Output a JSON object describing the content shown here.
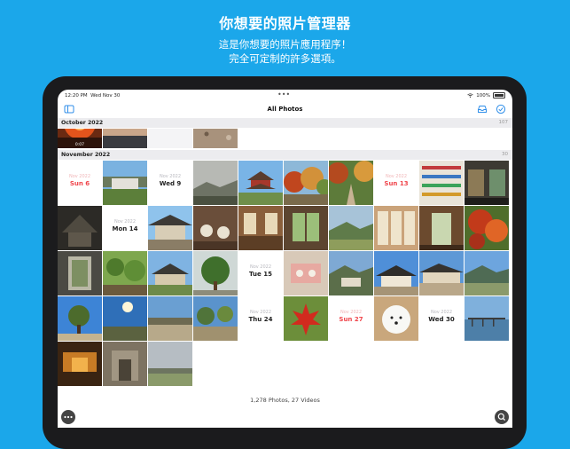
{
  "marketing": {
    "headline": "你想要的照片管理器",
    "subline_1": "這是你想要的照片應用程序！",
    "subline_2": "完全可定制的許多選項。"
  },
  "status_bar": {
    "time": "12:20 PM",
    "date": "Wed Nov 30",
    "battery": "100%"
  },
  "nav": {
    "title": "All Photos",
    "left_icon": "sidebar-icon",
    "right_icons": [
      "tray-icon",
      "checkmark-circle-icon"
    ]
  },
  "sections": [
    {
      "name": "October 2022",
      "count": "107"
    },
    {
      "name": "November 2022",
      "count": "30"
    }
  ],
  "october_tiles": [
    {
      "kind": "photo",
      "scene": "sunset-orange",
      "duration": "0:07"
    },
    {
      "kind": "photo",
      "scene": "dusk-sky"
    },
    {
      "kind": "photo",
      "scene": "blank"
    },
    {
      "kind": "photo",
      "scene": "gravel"
    }
  ],
  "november_tiles": [
    {
      "kind": "date",
      "month": "Nov 2022",
      "day": "Sun 6",
      "sunday": true
    },
    {
      "kind": "photo",
      "scene": "building-garden"
    },
    {
      "kind": "date",
      "month": "Nov 2022",
      "day": "Wed 9",
      "sunday": false
    },
    {
      "kind": "photo",
      "scene": "hazy-mountains"
    },
    {
      "kind": "photo",
      "scene": "pagoda"
    },
    {
      "kind": "photo",
      "scene": "autumn-trees"
    },
    {
      "kind": "photo",
      "scene": "autumn-path"
    },
    {
      "kind": "date",
      "month": "Nov 2022",
      "day": "Sun 13",
      "sunday": true
    },
    {
      "kind": "photo",
      "scene": "shop-shelves"
    },
    {
      "kind": "photo",
      "scene": "shop-interior"
    },
    {
      "kind": "photo",
      "scene": "dark-hut"
    },
    {
      "kind": "date",
      "month": "Nov 2022",
      "day": "Mon 14",
      "sunday": false
    },
    {
      "kind": "photo",
      "scene": "hanok-roof"
    },
    {
      "kind": "photo",
      "scene": "tea-cups"
    },
    {
      "kind": "photo",
      "scene": "wood-interior"
    },
    {
      "kind": "photo",
      "scene": "window-view"
    },
    {
      "kind": "photo",
      "scene": "valley"
    },
    {
      "kind": "photo",
      "scene": "sliding-doors"
    },
    {
      "kind": "photo",
      "scene": "door-frame"
    },
    {
      "kind": "photo",
      "scene": "red-maple"
    },
    {
      "kind": "photo",
      "scene": "gate-frame"
    },
    {
      "kind": "photo",
      "scene": "garden-green"
    },
    {
      "kind": "photo",
      "scene": "hanok-house"
    },
    {
      "kind": "photo",
      "scene": "pine-tree"
    },
    {
      "kind": "date",
      "month": "Nov 2022",
      "day": "Tue 15",
      "sunday": false
    },
    {
      "kind": "photo",
      "scene": "tea-tray"
    },
    {
      "kind": "photo",
      "scene": "mountain-house"
    },
    {
      "kind": "photo",
      "scene": "hanok-blue-sky"
    },
    {
      "kind": "photo",
      "scene": "hanok-courtyard"
    },
    {
      "kind": "photo",
      "scene": "coast-hills"
    },
    {
      "kind": "photo",
      "scene": "tree-blue-sky"
    },
    {
      "kind": "photo",
      "scene": "sun-flare"
    },
    {
      "kind": "photo",
      "scene": "village-wall"
    },
    {
      "kind": "photo",
      "scene": "courtyard-trees"
    },
    {
      "kind": "date",
      "month": "Nov 2022",
      "day": "Thu 24",
      "sunday": false
    },
    {
      "kind": "photo",
      "scene": "maple-leaf"
    },
    {
      "kind": "date",
      "month": "Nov 2022",
      "day": "Sun 27",
      "sunday": true
    },
    {
      "kind": "photo",
      "scene": "white-dog"
    },
    {
      "kind": "date",
      "month": "Nov 2022",
      "day": "Wed 30",
      "sunday": false
    },
    {
      "kind": "photo",
      "scene": "pier-lake"
    },
    {
      "kind": "photo",
      "scene": "amber-room"
    },
    {
      "kind": "photo",
      "scene": "stone-ruins"
    },
    {
      "kind": "photo",
      "scene": "cloudy-field"
    }
  ],
  "footer": {
    "summary": "1,278 Photos, 27 Videos"
  },
  "controls": {
    "more_icon": "ellipsis-icon",
    "search_icon": "search-icon"
  },
  "colors": {
    "background": "#1ba7ea",
    "accent": "#2f8ee9",
    "sunday_red": "#f0464c"
  }
}
